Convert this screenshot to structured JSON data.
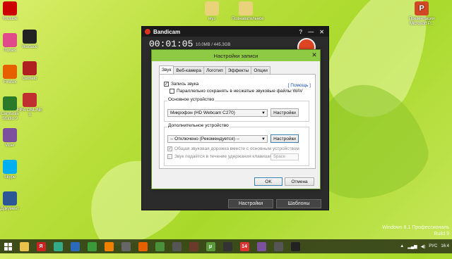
{
  "desktop": {
    "icons_left": [
      {
        "label": "Youtube",
        "icon": "youtube-icon",
        "color": "#c00"
      },
      {
        "label": "iTunes",
        "icon": "itunes-icon",
        "color": "#e04a8a"
      },
      {
        "label": "Firefox",
        "icon": "firefox-icon",
        "color": "#e66000"
      },
      {
        "label": "Camtasia Studio 9",
        "icon": "camtasia-icon",
        "color": "#2a7a2a"
      },
      {
        "label": "Viber",
        "icon": "viber-icon",
        "color": "#7b519d"
      },
      {
        "label": "Skype",
        "icon": "skype-icon",
        "color": "#00aff0"
      },
      {
        "label": "Документ",
        "icon": "document-icon",
        "color": "#2b5797"
      }
    ],
    "icons_col2": [
      {
        "label": "Warface",
        "icon": "warface-icon",
        "color": "#222"
      },
      {
        "label": "Gamelo",
        "icon": "gamelo-icon",
        "color": "#b02020"
      },
      {
        "label": "FIFA ONLINE 3",
        "icon": "fifa-icon",
        "color": "#c03030"
      }
    ],
    "icons_top": [
      {
        "label": "муз",
        "icon": "folder-icon",
        "color": "#e8d27a"
      },
      {
        "label": "Познавательное",
        "icon": "folder-icon",
        "color": "#e8d27a"
      }
    ],
    "icon_top_right": {
      "label": "Презентация Microsoft P...",
      "icon": "powerpoint-icon",
      "color": "#d24726"
    },
    "watermark_line1": "Windows 8.1 Профессиональ",
    "watermark_line2": "Build 9"
  },
  "bandicam": {
    "title": "Bandicam",
    "ctrl_help": "?",
    "ctrl_min": "—",
    "ctrl_close": "✕",
    "timer": "00:01:05",
    "size": "10.0MB / 445.3GB",
    "btn_settings": "Настройки",
    "btn_templates": "Шаблоны"
  },
  "dialog": {
    "title": "Настройки записи",
    "close": "✕",
    "tabs": [
      "Звук",
      "Веб-камера",
      "Логотип",
      "Эффекты",
      "Опции"
    ],
    "active_tab": 0,
    "help_link": "[ Помощь ]",
    "record_sound": {
      "label": "Запись звука",
      "checked": true
    },
    "save_parallel": {
      "label": "Параллельно сохранять в несжатые звуковые файлы WAV",
      "checked": false
    },
    "primary_group_label": "Основное устройство",
    "primary_device": "Микрофон (HD Webcam C270)",
    "primary_settings_btn": "Настройки",
    "secondary_group_label": "Дополнительное устройство",
    "secondary_device": "-- Отключено (Рекомендуется) --",
    "secondary_settings_btn": "Настройки",
    "mix_track": {
      "label": "Общая звуковая дорожка вместе с основным устройством",
      "checked": true
    },
    "hold_key": {
      "label": "Звук подаётся в течение удержания клавиши",
      "checked": false
    },
    "hold_key_value": "Space",
    "ok": "OK",
    "cancel": "Отмена"
  },
  "taskbar": {
    "items": [
      {
        "icon": "explorer-icon",
        "color": "#e8c24a",
        "text": ""
      },
      {
        "icon": "yandex-icon",
        "color": "#c22",
        "text": "Я"
      },
      {
        "icon": "chrome-tab-icon",
        "color": "#3a8",
        "text": ""
      },
      {
        "icon": "windows-icon",
        "color": "#2a6ab8",
        "text": ""
      },
      {
        "icon": "store-icon",
        "color": "#3a9a3a",
        "text": ""
      },
      {
        "icon": "vlc-icon",
        "color": "#f08000",
        "text": ""
      },
      {
        "icon": "player-icon",
        "color": "#666",
        "text": ""
      },
      {
        "icon": "firefox-icon",
        "color": "#e66000",
        "text": ""
      },
      {
        "icon": "chrome-icon",
        "color": "#4a8f3a",
        "text": ""
      },
      {
        "icon": "wot-icon",
        "color": "#555",
        "text": ""
      },
      {
        "icon": "game-icon",
        "color": "#6b3a2a",
        "text": ""
      },
      {
        "icon": "utorrent-icon",
        "color": "#5a9a3a",
        "text": "μ"
      },
      {
        "icon": "steam-icon",
        "color": "#333",
        "text": ""
      },
      {
        "icon": "badge-icon",
        "color": "#d33",
        "text": "14"
      },
      {
        "icon": "viber-icon",
        "color": "#7b519d",
        "text": ""
      },
      {
        "icon": "wot2-icon",
        "color": "#555",
        "text": ""
      },
      {
        "icon": "bandicam-icon",
        "color": "#222",
        "text": ""
      }
    ],
    "tray_lang": "РУС",
    "tray_time": "16:4"
  }
}
